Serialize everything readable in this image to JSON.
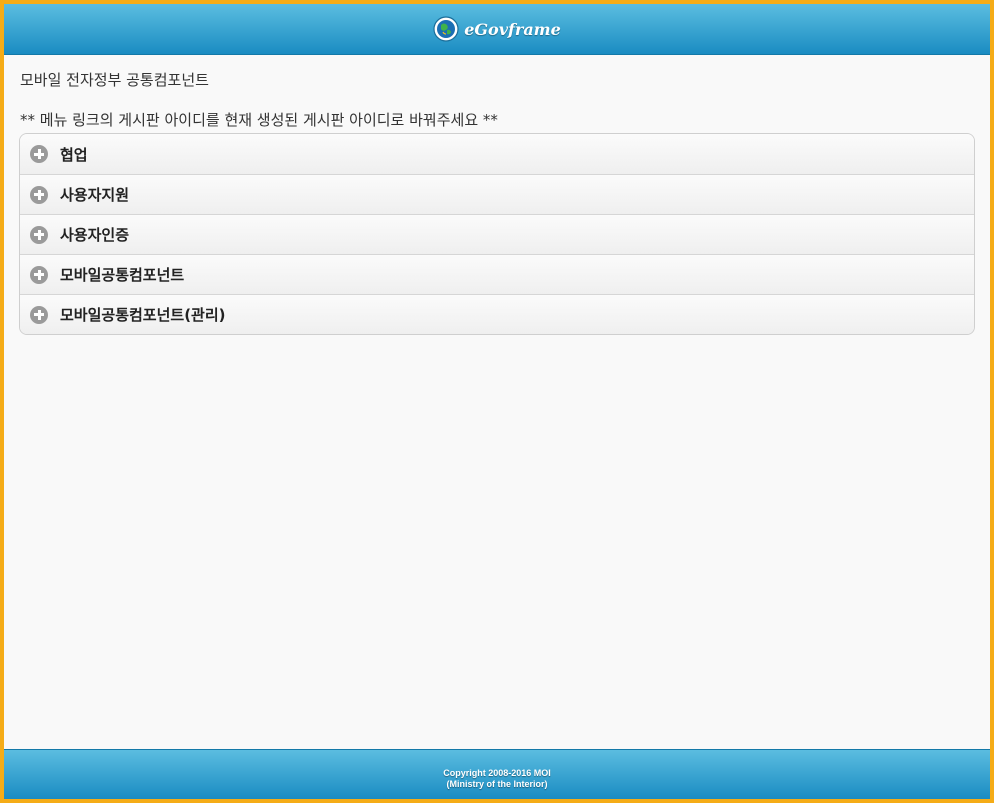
{
  "header": {
    "logo_icon": "globe-emblem-icon",
    "logo_text": "eGovframe"
  },
  "main": {
    "intro": "모바일 전자정부 공통컴포넌트",
    "notice": "** 메뉴 링크의 게시판 아이디를 현재 생성된 게시판 아이디로 바꿔주세요 **",
    "menu": [
      {
        "label": "협업",
        "icon": "plus-circle-icon"
      },
      {
        "label": "사용자지원",
        "icon": "plus-circle-icon"
      },
      {
        "label": "사용자인증",
        "icon": "plus-circle-icon"
      },
      {
        "label": "모바일공통컴포넌트",
        "icon": "plus-circle-icon"
      },
      {
        "label": "모바일공통컴포넌트(관리)",
        "icon": "plus-circle-icon"
      }
    ]
  },
  "footer": {
    "copyright": "Copyright 2008-2016 MOI",
    "ministry": "(Ministry of the Interior)"
  },
  "colors": {
    "frame_border": "#f5ac17",
    "bar_top": "#5bbde0",
    "bar_bottom": "#1a8cc2",
    "background": "#f9f9f9"
  }
}
